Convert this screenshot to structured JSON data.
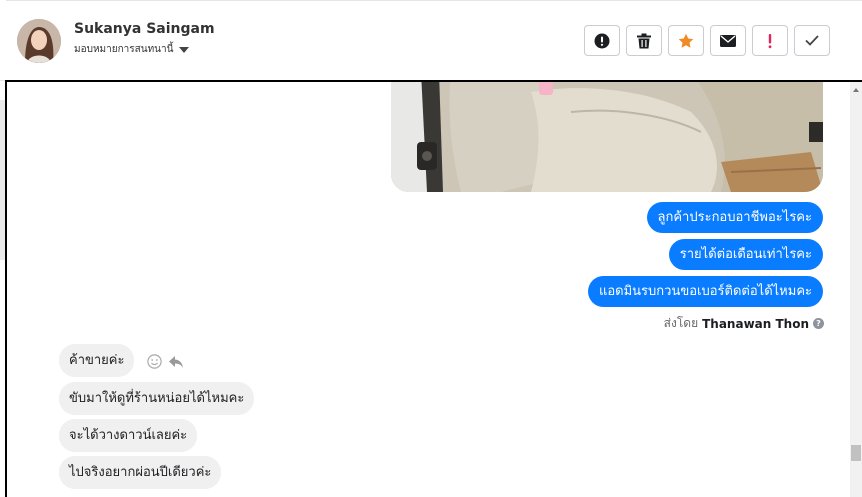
{
  "header": {
    "contact_name": "Sukanya Saingam",
    "assign_label": "มอบหมายการสนทนานี้",
    "actions": [
      {
        "name": "spam-button",
        "icon": "exclamation-circle-icon"
      },
      {
        "name": "delete-button",
        "icon": "trash-icon"
      },
      {
        "name": "star-button",
        "icon": "star-icon",
        "color": "#f08a24"
      },
      {
        "name": "mark-unread-button",
        "icon": "envelope-icon"
      },
      {
        "name": "follow-up-button",
        "icon": "exclamation-icon",
        "color": "#e0245e"
      },
      {
        "name": "done-button",
        "icon": "check-icon"
      }
    ]
  },
  "conversation": {
    "outgoing": [
      "ลูกค้าประกอบอาชีพอะไรคะ",
      "รายได้ต่อเดือนเท่าไรคะ",
      "แอดมินรบกวนขอเบอร์ติดต่อได้ไหมคะ"
    ],
    "sent_by_prefix": "ส่งโดย",
    "sent_by_name": "Thanawan Thon",
    "incoming": [
      "ค้าขายค่ะ",
      "ขับมาให้ดูที่ร้านหน่อยได้ไหมคะ",
      "จะได้วางดาวน์เลยค่ะ",
      "ไปจริงอยากผ่อนปีเดียวค่ะ"
    ]
  },
  "colors": {
    "outgoing_bubble": "#0a7cff",
    "incoming_bubble": "#f0f0f0",
    "star": "#f08a24",
    "follow_up": "#e0245e"
  }
}
